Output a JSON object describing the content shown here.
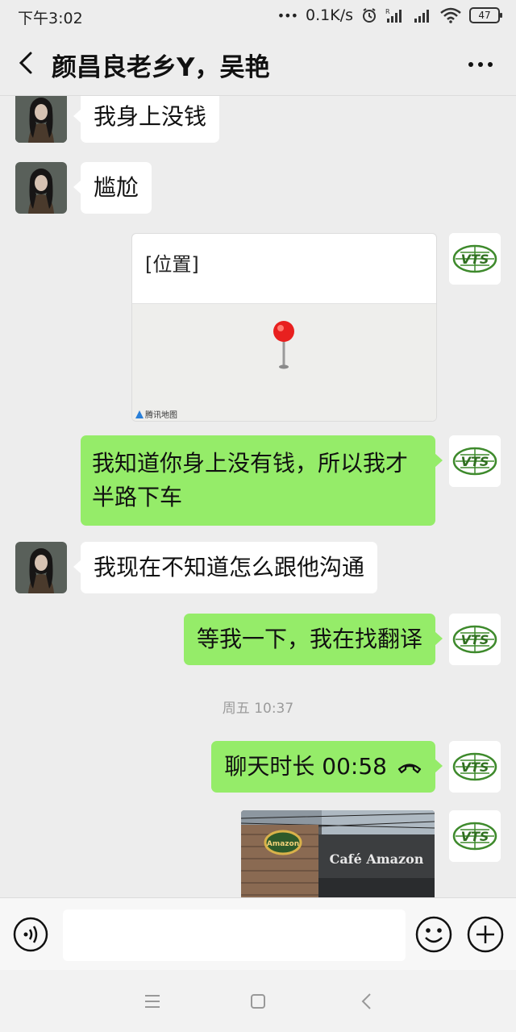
{
  "status_bar": {
    "time": "下午3:02",
    "network_speed": "0.1K/s",
    "battery": "47"
  },
  "header": {
    "title": "颜昌良老乡Y，吴艳"
  },
  "messages": {
    "m1": "我身上没钱",
    "m2": "尴尬",
    "location_title": "[位置]",
    "map_provider": "腾讯地图",
    "m4_line1": "我知道你身上没有钱，所以我才",
    "m4_line2": "半路下车",
    "m5": "我现在不知道怎么跟他沟通",
    "m6": "等我一下，我在找翻译",
    "timestamp": "周五 10:37",
    "call": "聊天时长 00:58"
  },
  "photo": {
    "sign_text": "Café Amazon",
    "logo_text": "Amazon"
  },
  "avatar_logo_text": "VTS",
  "input": {
    "placeholder": ""
  },
  "colors": {
    "outgoing_bubble": "#95ec69",
    "incoming_bubble": "#ffffff",
    "background": "#ededed",
    "map_pin": "#e8201f"
  }
}
